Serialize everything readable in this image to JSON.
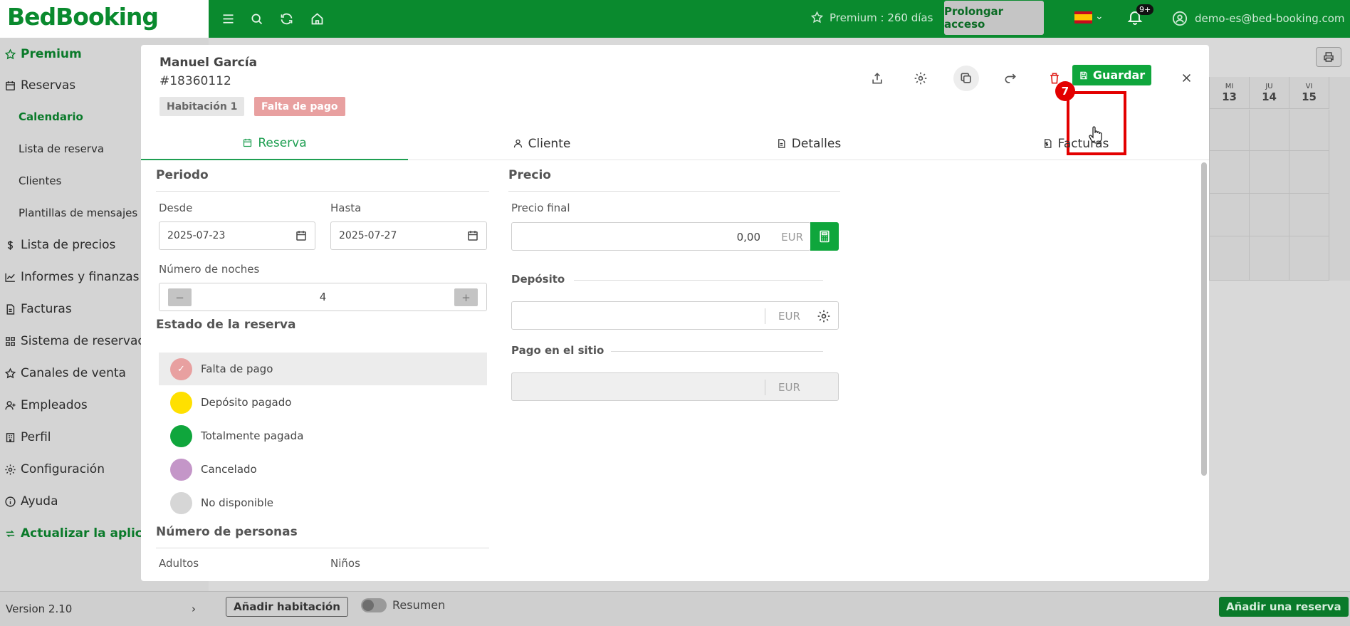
{
  "brand": {
    "name": "BedBooking"
  },
  "topbar": {
    "premium_text": "Premium : 260 días",
    "prolongar_label": "Prolongar acceso",
    "notifications_count": "9+",
    "user_email": "demo-es@bed-booking.com"
  },
  "sidebar": {
    "premium": "Premium",
    "reservas": "Reservas",
    "sub": [
      "Calendario",
      "Lista de reserva",
      "Clientes",
      "Plantillas de mensajes"
    ],
    "items": [
      "Lista de precios",
      "Informes y finanzas",
      "Facturas",
      "Sistema de reservación",
      "Canales de venta",
      "Empleados",
      "Perfil",
      "Configuración",
      "Ayuda"
    ],
    "update": "Actualizar la aplicación",
    "version": "Version 2.10"
  },
  "background": {
    "days": [
      {
        "name": "MI",
        "num": "13"
      },
      {
        "name": "JU",
        "num": "14"
      },
      {
        "name": "VI",
        "num": "15"
      }
    ],
    "add_room": "Añadir habitación",
    "summary_toggle": "Resumen",
    "add_reservation": "Añadir una reserva"
  },
  "modal": {
    "guest_name": "Manuel García",
    "booking_id": "#18360112",
    "room_badge": "Habitación 1",
    "status_badge": "Falta de pago",
    "save_label": "Guardar",
    "step_number": "7",
    "tabs": [
      "Reserva",
      "Cliente",
      "Detalles",
      "Facturas"
    ],
    "period": {
      "title": "Periodo",
      "from_label": "Desde",
      "from_value": "2025-07-23",
      "to_label": "Hasta",
      "to_value": "2025-07-27",
      "nights_label": "Número de noches",
      "nights_value": "4",
      "minus": "−",
      "plus": "+"
    },
    "status": {
      "title": "Estado de la reserva",
      "options": [
        "Falta de pago",
        "Depósito pagado",
        "Totalmente pagada",
        "Cancelado",
        "No disponible"
      ],
      "colors": [
        "#e8a0a0",
        "#ffe000",
        "#0fa63c",
        "#c496c8",
        "#d6d6d6"
      ]
    },
    "persons": {
      "title": "Número de personas",
      "adults_label": "Adultos",
      "children_label": "Niños"
    },
    "price": {
      "title": "Precio",
      "final_label": "Precio final",
      "final_value": "0,00",
      "currency": "EUR",
      "deposit_label": "Depósito",
      "onsite_label": "Pago en el sitio"
    }
  },
  "colors": {
    "brand_green": "#0a8a2e",
    "accent_green": "#0fa63c",
    "delete_red": "#e0201b",
    "highlight_red": "#e30000"
  }
}
